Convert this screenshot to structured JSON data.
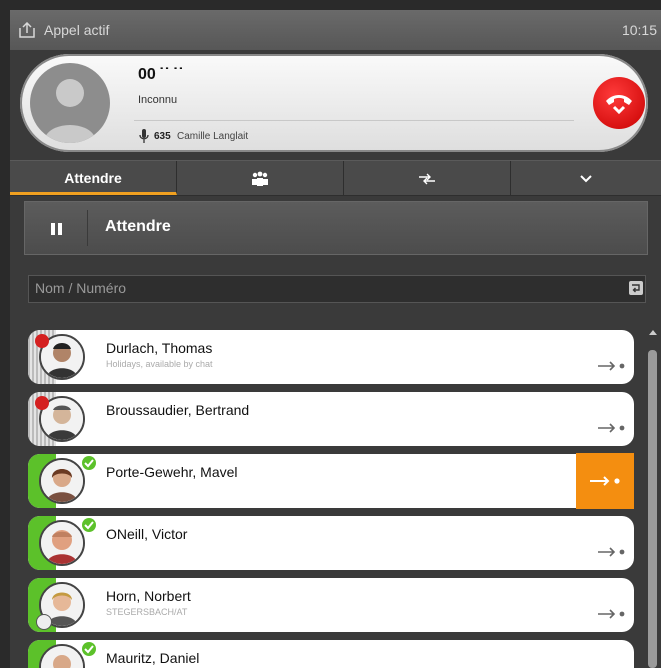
{
  "titlebar": {
    "title": "Appel actif",
    "time": "10:15"
  },
  "call": {
    "number": "00 ˙˙ ˙˙",
    "status": "Inconnu",
    "extension": "635",
    "agent": "Camille Langlait"
  },
  "tabs": [
    {
      "label": "Attendre",
      "icon": ""
    },
    {
      "label": "",
      "icon": "group-icon"
    },
    {
      "label": "",
      "icon": "transfer-arrows-icon"
    },
    {
      "label": "",
      "icon": "chevron-down-icon"
    }
  ],
  "hold": {
    "label": "Attendre"
  },
  "search": {
    "placeholder": "Nom / Numéro"
  },
  "contacts": [
    {
      "name": "Durlach, Thomas",
      "status": "Holidays, available by chat",
      "presence": "busy"
    },
    {
      "name": "Broussaudier, Bertrand",
      "status": "",
      "presence": "busy"
    },
    {
      "name": "Porte-Gewehr, Mavel",
      "status": "",
      "presence": "available"
    },
    {
      "name": "ONeill, Victor",
      "status": "",
      "presence": "available"
    },
    {
      "name": "Horn, Norbert",
      "status": "STEGERSBACH/AT",
      "presence": "available"
    },
    {
      "name": "Mauritz, Daniel",
      "status": "",
      "presence": "available"
    }
  ],
  "colors": {
    "accent": "#f48e10",
    "available": "#5cc12a",
    "busy": "#d42020",
    "hangup": "#d40000"
  }
}
